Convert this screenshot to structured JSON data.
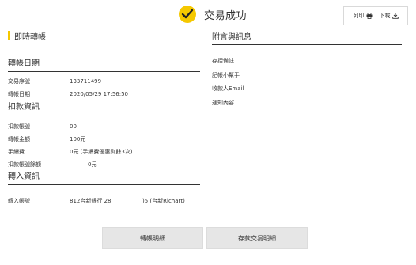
{
  "header": {
    "status_text": "交易成功",
    "print_label": "列印",
    "download_label": "下載"
  },
  "left": {
    "main_title": "即時轉帳",
    "transfer_date_section": {
      "title": "轉帳日期",
      "rows": [
        {
          "label": "交易序號",
          "value": "133711499"
        },
        {
          "label": "轉帳日期",
          "value": "2020/05/29 17:56:50"
        }
      ]
    },
    "debit_section": {
      "title": "扣款資訊",
      "rows": [
        {
          "label": "扣款帳號",
          "value": "00"
        },
        {
          "label": "轉帳金額",
          "value": "100元"
        },
        {
          "label": "手續費",
          "value": "0元 (手續費優惠剩餘3次)"
        },
        {
          "label": "扣款帳號餘額",
          "value": "0元"
        }
      ]
    },
    "credit_section": {
      "title": "轉入資訊",
      "rows": [
        {
          "label": "轉入帳號",
          "value": "812台新銀行 28",
          "value2": ")5 (台新Richart)"
        }
      ]
    }
  },
  "right": {
    "title": "附言與訊息",
    "rows": [
      {
        "label": "存摺備註"
      },
      {
        "label": "記帳小幫手"
      },
      {
        "label": "收款人Email"
      },
      {
        "label": "通知內容"
      }
    ]
  },
  "buttons": {
    "transfer_details": "轉帳明細",
    "deposit_details": "存款交易明細"
  }
}
